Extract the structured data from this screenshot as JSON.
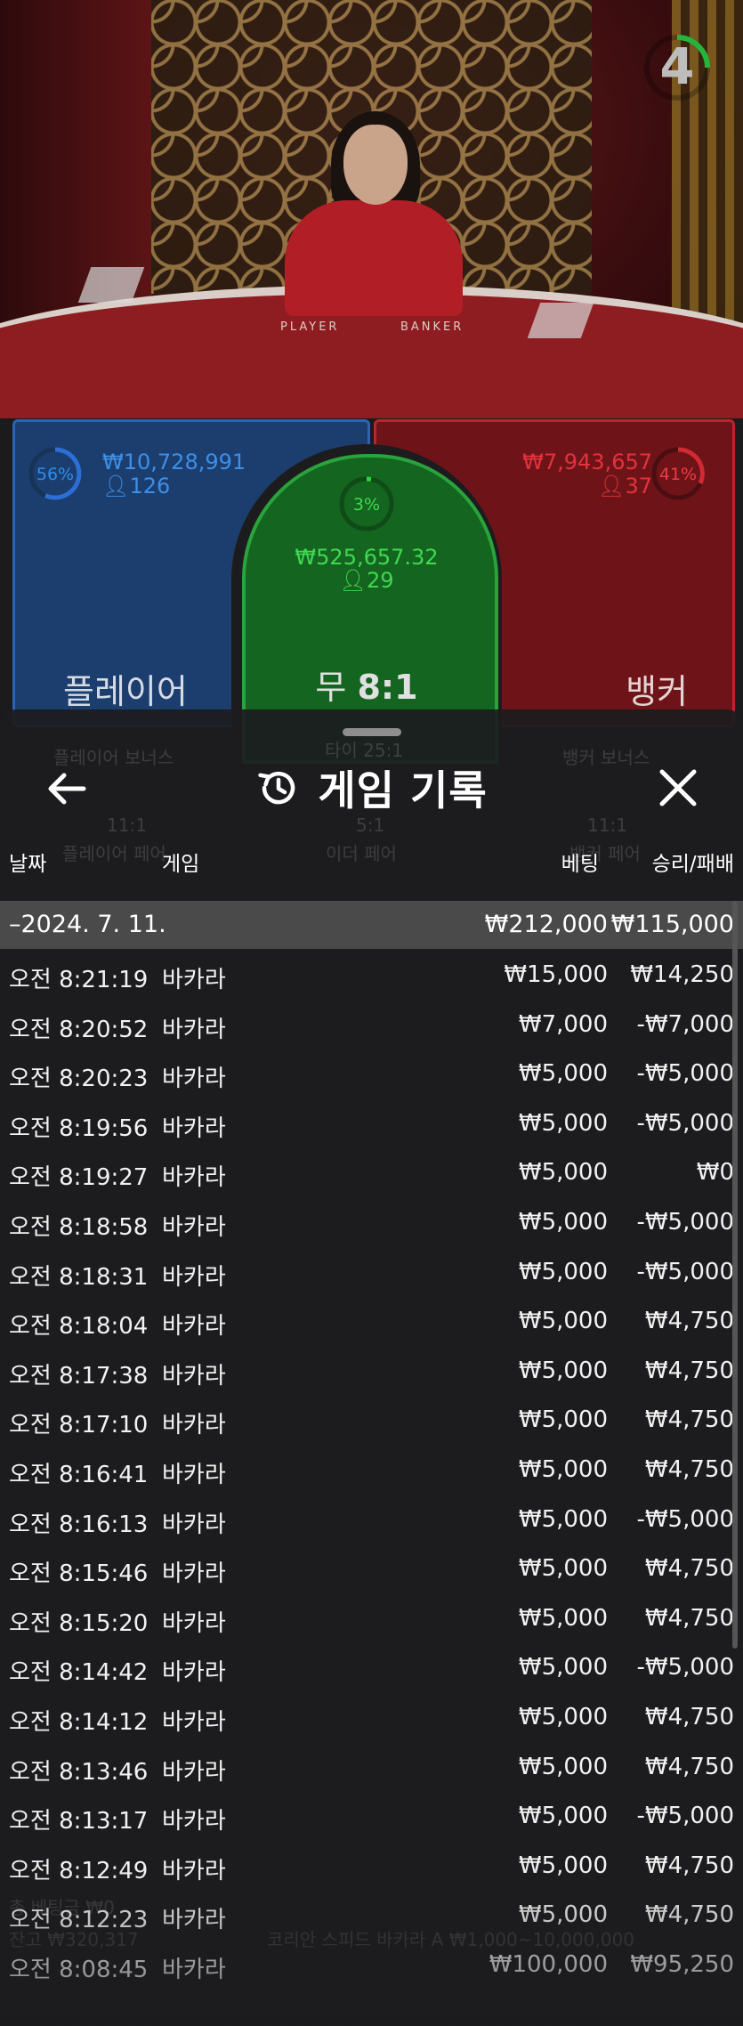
{
  "table": {
    "timer": "4",
    "table_label_player": "PLAYER",
    "table_label_banker": "BANKER"
  },
  "bets": {
    "player": {
      "pct": "56%",
      "amount": "₩10,728,991",
      "count": "126",
      "label": "플레이어",
      "color": "#2b6fd6"
    },
    "tie": {
      "pct": "3%",
      "amount": "₩525,657.32",
      "count": "29",
      "label": "무",
      "odds": "8:1",
      "color": "#29a33b"
    },
    "banker": {
      "pct": "41%",
      "amount": "₩7,943,657",
      "count": "37",
      "label": "뱅커",
      "color": "#d22a33"
    }
  },
  "panel": {
    "title": "게임 기록",
    "ghost": {
      "player_bonus": "플레이어 보너스",
      "tie_bonus": "타이 25:1",
      "banker_bonus": "뱅커 보너스",
      "player_pair_odds": "11:1",
      "player_pair": "플레이어 페어",
      "either_pair_odds": "5:1",
      "either_pair": "이더 페어",
      "banker_pair_odds": "11:1",
      "banker_pair": "뱅커 페어",
      "balance": "잔고 ₩320,317",
      "total_bet": "총 베팅금 ₩0",
      "table_name": "코리안 스피드 바카라 A ₩1,000~10,000,000"
    },
    "columns": {
      "date": "날짜",
      "game": "게임",
      "bet": "베팅",
      "result": "승리/패배"
    },
    "summary": {
      "date": "–2024. 7. 11.",
      "bet": "₩212,000",
      "result": "₩115,000"
    },
    "rows": [
      {
        "time": "오전 8:21:19",
        "game": "바카라",
        "bet": "₩15,000",
        "result": "₩14,250"
      },
      {
        "time": "오전 8:20:52",
        "game": "바카라",
        "bet": "₩7,000",
        "result": "-₩7,000"
      },
      {
        "time": "오전 8:20:23",
        "game": "바카라",
        "bet": "₩5,000",
        "result": "-₩5,000"
      },
      {
        "time": "오전 8:19:56",
        "game": "바카라",
        "bet": "₩5,000",
        "result": "-₩5,000"
      },
      {
        "time": "오전 8:19:27",
        "game": "바카라",
        "bet": "₩5,000",
        "result": "₩0"
      },
      {
        "time": "오전 8:18:58",
        "game": "바카라",
        "bet": "₩5,000",
        "result": "-₩5,000"
      },
      {
        "time": "오전 8:18:31",
        "game": "바카라",
        "bet": "₩5,000",
        "result": "-₩5,000"
      },
      {
        "time": "오전 8:18:04",
        "game": "바카라",
        "bet": "₩5,000",
        "result": "₩4,750"
      },
      {
        "time": "오전 8:17:38",
        "game": "바카라",
        "bet": "₩5,000",
        "result": "₩4,750"
      },
      {
        "time": "오전 8:17:10",
        "game": "바카라",
        "bet": "₩5,000",
        "result": "₩4,750"
      },
      {
        "time": "오전 8:16:41",
        "game": "바카라",
        "bet": "₩5,000",
        "result": "₩4,750"
      },
      {
        "time": "오전 8:16:13",
        "game": "바카라",
        "bet": "₩5,000",
        "result": "-₩5,000"
      },
      {
        "time": "오전 8:15:46",
        "game": "바카라",
        "bet": "₩5,000",
        "result": "₩4,750"
      },
      {
        "time": "오전 8:15:20",
        "game": "바카라",
        "bet": "₩5,000",
        "result": "₩4,750"
      },
      {
        "time": "오전 8:14:42",
        "game": "바카라",
        "bet": "₩5,000",
        "result": "-₩5,000"
      },
      {
        "time": "오전 8:14:12",
        "game": "바카라",
        "bet": "₩5,000",
        "result": "₩4,750"
      },
      {
        "time": "오전 8:13:46",
        "game": "바카라",
        "bet": "₩5,000",
        "result": "₩4,750"
      },
      {
        "time": "오전 8:13:17",
        "game": "바카라",
        "bet": "₩5,000",
        "result": "-₩5,000"
      },
      {
        "time": "오전 8:12:49",
        "game": "바카라",
        "bet": "₩5,000",
        "result": "₩4,750"
      },
      {
        "time": "오전 8:12:23",
        "game": "바카라",
        "bet": "₩5,000",
        "result": "₩4,750"
      },
      {
        "time": "오전 8:08:45",
        "game": "바카라",
        "bet": "₩100,000",
        "result": "₩95,250"
      }
    ]
  }
}
